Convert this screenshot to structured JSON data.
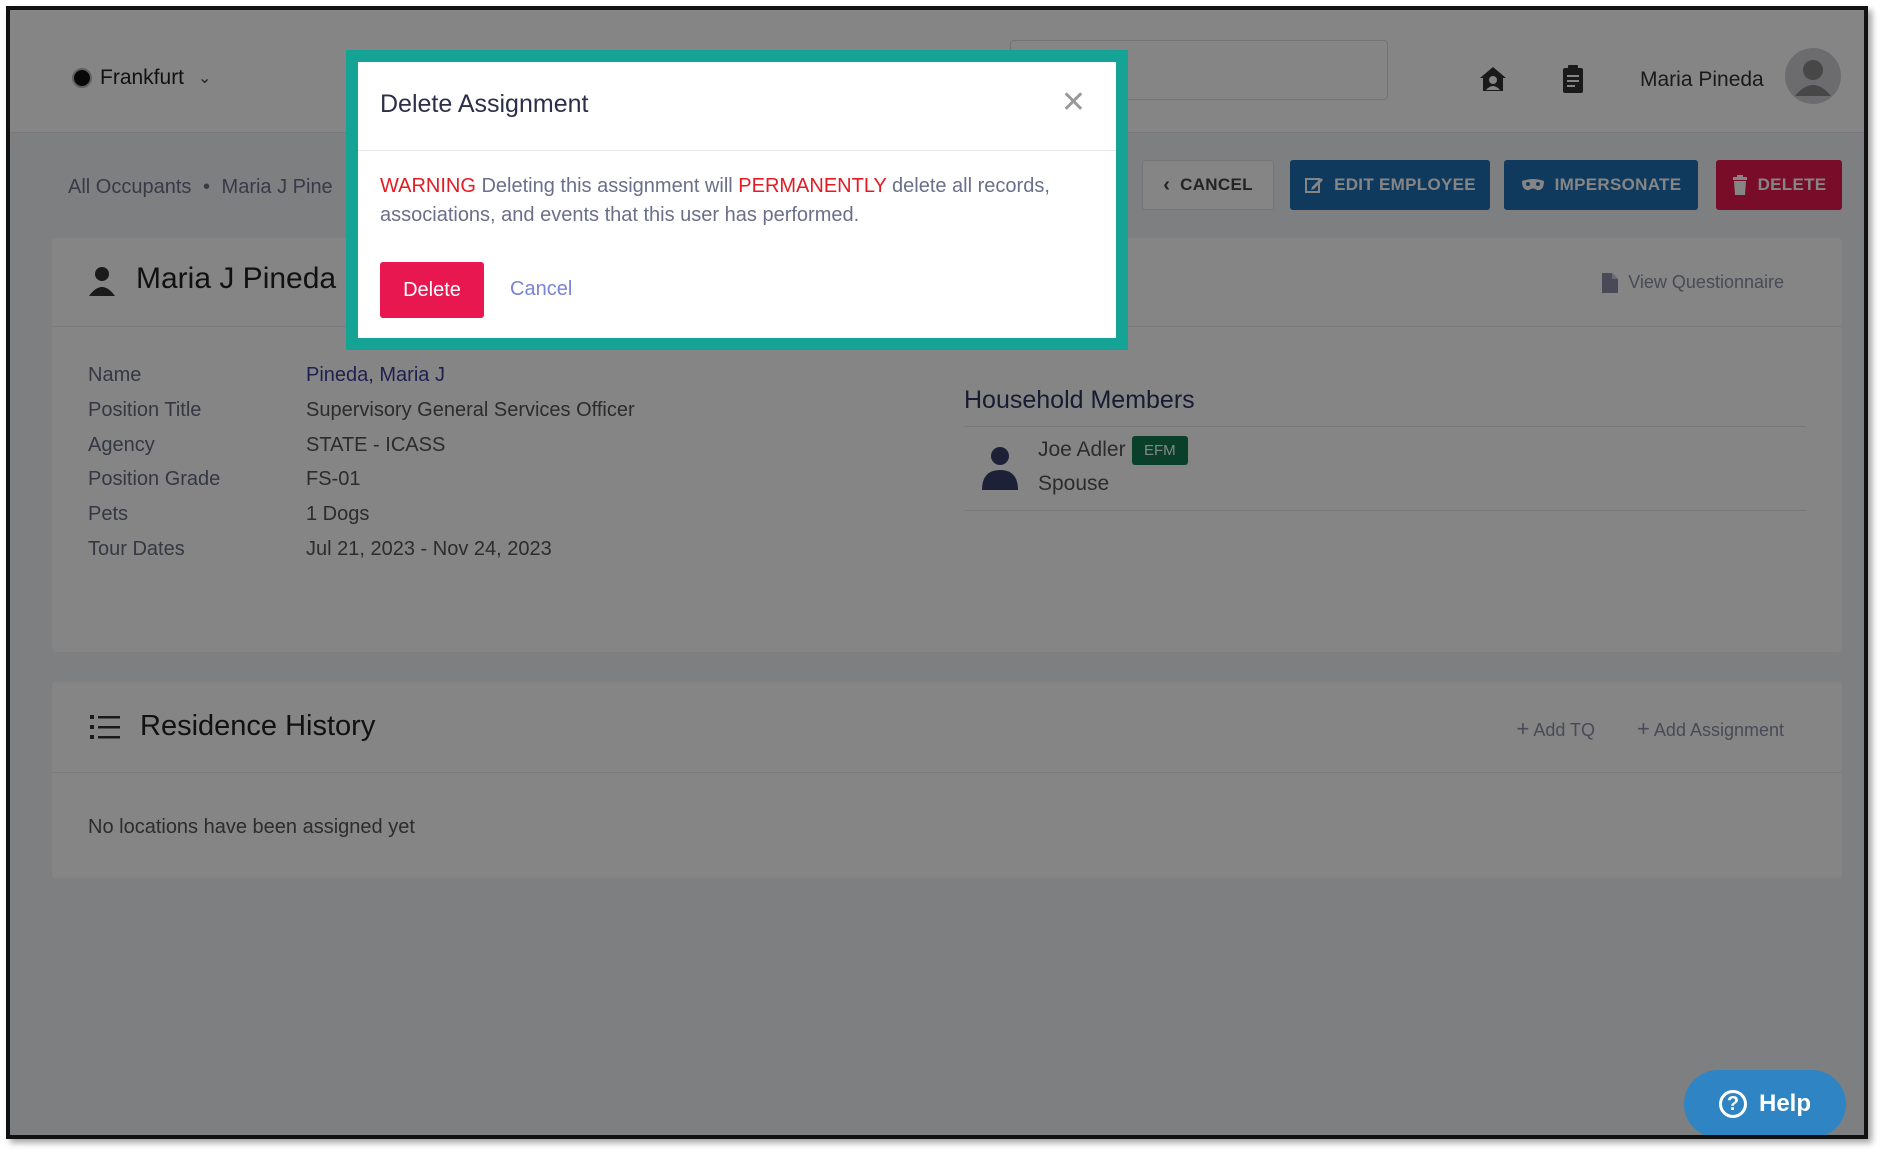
{
  "topbar": {
    "location": "Frankfurt",
    "user_name": "Maria Pineda",
    "icons": [
      "house-user-icon",
      "clipboard-list-icon",
      "avatar"
    ]
  },
  "breadcrumb": {
    "root": "All Occupants",
    "separator": "•",
    "current": "Maria J Pine"
  },
  "actions": {
    "cancel": "CANCEL",
    "edit_employee": "EDIT EMPLOYEE",
    "impersonate": "IMPERSONATE",
    "delete": "DELETE"
  },
  "employee": {
    "full_name": "Maria J Pineda",
    "view_questionnaire": "View Questionnaire",
    "fields": [
      {
        "label": "Name",
        "value": "Pineda, Maria J"
      },
      {
        "label": "Position Title",
        "value": "Supervisory General Services Officer"
      },
      {
        "label": "Agency",
        "value": "STATE - ICASS"
      },
      {
        "label": "Position Grade",
        "value": "FS-01"
      },
      {
        "label": "Pets",
        "value": "1 Dogs"
      },
      {
        "label": "Tour Dates",
        "value": "Jul 21, 2023 - Nov 24, 2023"
      }
    ]
  },
  "household": {
    "title": "Household Members",
    "members": [
      {
        "name": "Joe Adler",
        "badge": "EFM",
        "relation": "Spouse"
      }
    ]
  },
  "residence": {
    "title": "Residence History",
    "add_tq": "Add TQ",
    "add_assignment": "Add Assignment",
    "empty": "No locations have been assigned yet"
  },
  "modal": {
    "title": "Delete Assignment",
    "warning_word": "WARNING",
    "text_1": " Deleting this assignment will ",
    "permanently": "PERMANENTLY",
    "text_2": " delete all records, associations, and events that this user has performed.",
    "delete_label": "Delete",
    "cancel_label": "Cancel"
  },
  "help": {
    "label": "Help"
  },
  "colors": {
    "primary_blue": "#1f6fb2",
    "danger": "#e8174f",
    "modal_highlight": "#14a394",
    "efm_badge": "#157a52"
  }
}
